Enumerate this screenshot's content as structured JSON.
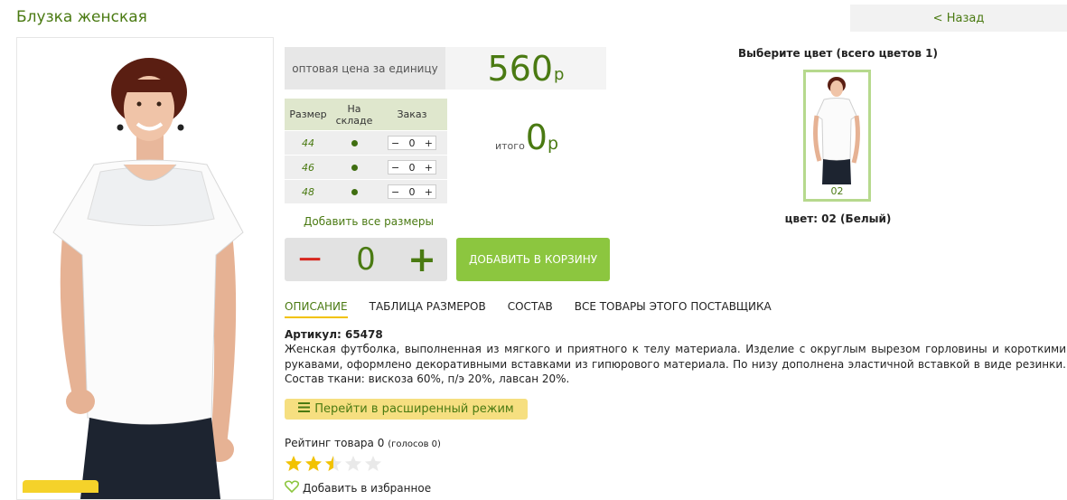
{
  "product": {
    "title": "Блузка женская",
    "back_label": "< Назад"
  },
  "price": {
    "label": "оптовая цена за единицу",
    "value": "560",
    "currency": "р"
  },
  "sizes_table": {
    "headers": [
      "Размер",
      "На складе",
      "Заказ"
    ],
    "rows": [
      {
        "size": "44",
        "in_stock": true,
        "qty": "0",
        "minus": "−",
        "plus": "+"
      },
      {
        "size": "46",
        "in_stock": true,
        "qty": "0",
        "minus": "−",
        "plus": "+"
      },
      {
        "size": "48",
        "in_stock": true,
        "qty": "0",
        "minus": "−",
        "plus": "+"
      }
    ]
  },
  "total": {
    "label": "итого",
    "value": "0",
    "currency": "р"
  },
  "add_all_sizes": "Добавить все размеры",
  "quantity": {
    "minus": "−",
    "value": "0",
    "plus": "+"
  },
  "add_to_cart": "ДОБАВИТЬ В КОРЗИНУ",
  "color_select": {
    "title": "Выберите цвет (всего цветов 1)",
    "swatches": [
      {
        "code": "02"
      }
    ],
    "selected_info": "цвет: 02 (Белый)"
  },
  "tabs": [
    {
      "label": "ОПИСАНИЕ",
      "active": true
    },
    {
      "label": "ТАБЛИЦА РАЗМЕРОВ",
      "active": false
    },
    {
      "label": "СОСТАВ",
      "active": false
    },
    {
      "label": "ВСЕ ТОВАРЫ ЭТОГО ПОСТАВЩИКА",
      "active": false
    }
  ],
  "description": {
    "article": "Артикул: 65478",
    "text": "Женская футболка, выполненная из мягкого и приятного к телу материала. Изделие с округлым вырезом горловины и короткими рукавами, оформлено декоративными вставками из гипюрового материала. По низу дополнена эластичной вставкой в виде резинки. Состав ткани: вискоза 60%, п/э 20%, лавсан 20%."
  },
  "extended_mode": "Перейти в расширенный режим",
  "rating": {
    "label": "Рейтинг товара 0",
    "votes": "(голосов 0)",
    "stars_filled": 2.5,
    "stars_total": 5
  },
  "favorites": "Добавить в избранное",
  "colors": {
    "accent": "#4a7a12",
    "button_green": "#8cc63f",
    "minus_red": "#d7261e",
    "yellow": "#f6df80",
    "star": "#f2c200"
  }
}
